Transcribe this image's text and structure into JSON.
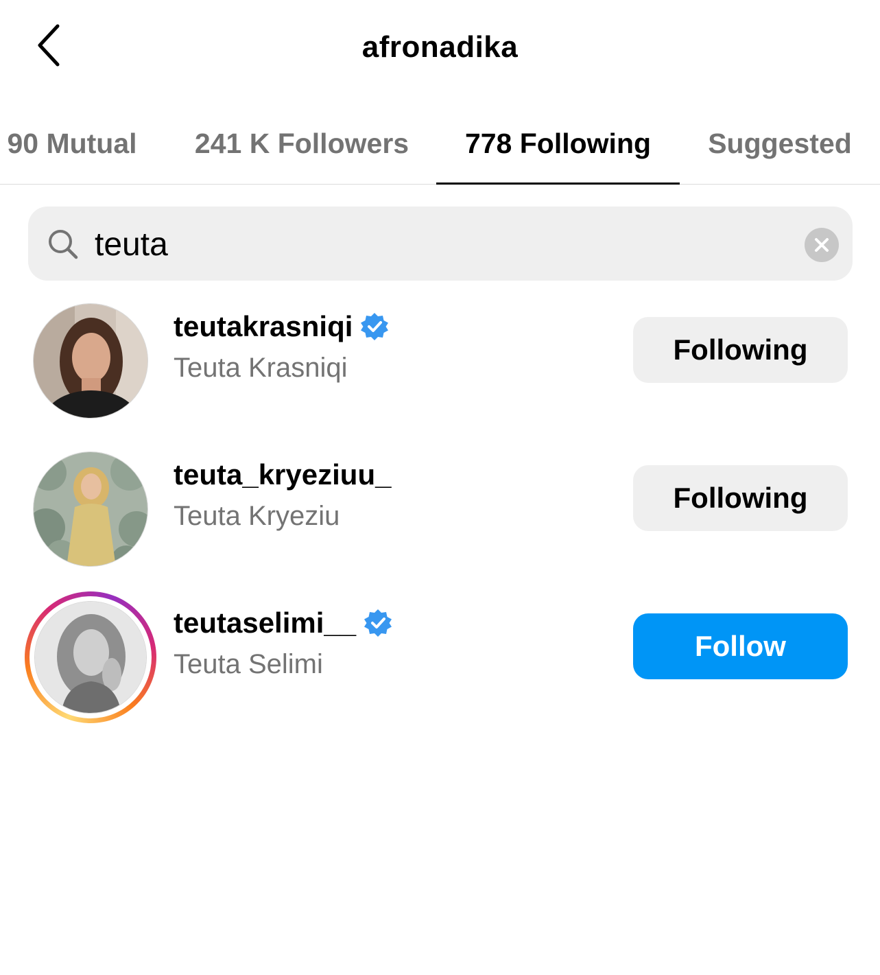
{
  "header": {
    "title": "afronadika",
    "back_icon": "chevron-left-icon"
  },
  "tabs": [
    {
      "label": "90 Mutual",
      "active": false
    },
    {
      "label": "241 K Followers",
      "active": false
    },
    {
      "label": "778 Following",
      "active": true
    },
    {
      "label": "Suggested",
      "active": false
    }
  ],
  "search": {
    "value": "teuta",
    "icon": "search-icon",
    "clear_icon": "clear-icon"
  },
  "results": [
    {
      "username": "teutakrasniqi",
      "full_name": "Teuta Krasniqi",
      "verified": true,
      "has_story": false,
      "button": "Following"
    },
    {
      "username": "teuta_kryeziuu_",
      "full_name": "Teuta Kryeziu",
      "verified": false,
      "has_story": false,
      "button": "Following"
    },
    {
      "username": "teutaselimi__",
      "full_name": "Teuta Selimi",
      "verified": true,
      "has_story": true,
      "button": "Follow"
    }
  ],
  "colors": {
    "accent": "#0095f6",
    "verified": "#3897f0",
    "secondary_text": "#737373",
    "button_grey": "#efefef"
  }
}
